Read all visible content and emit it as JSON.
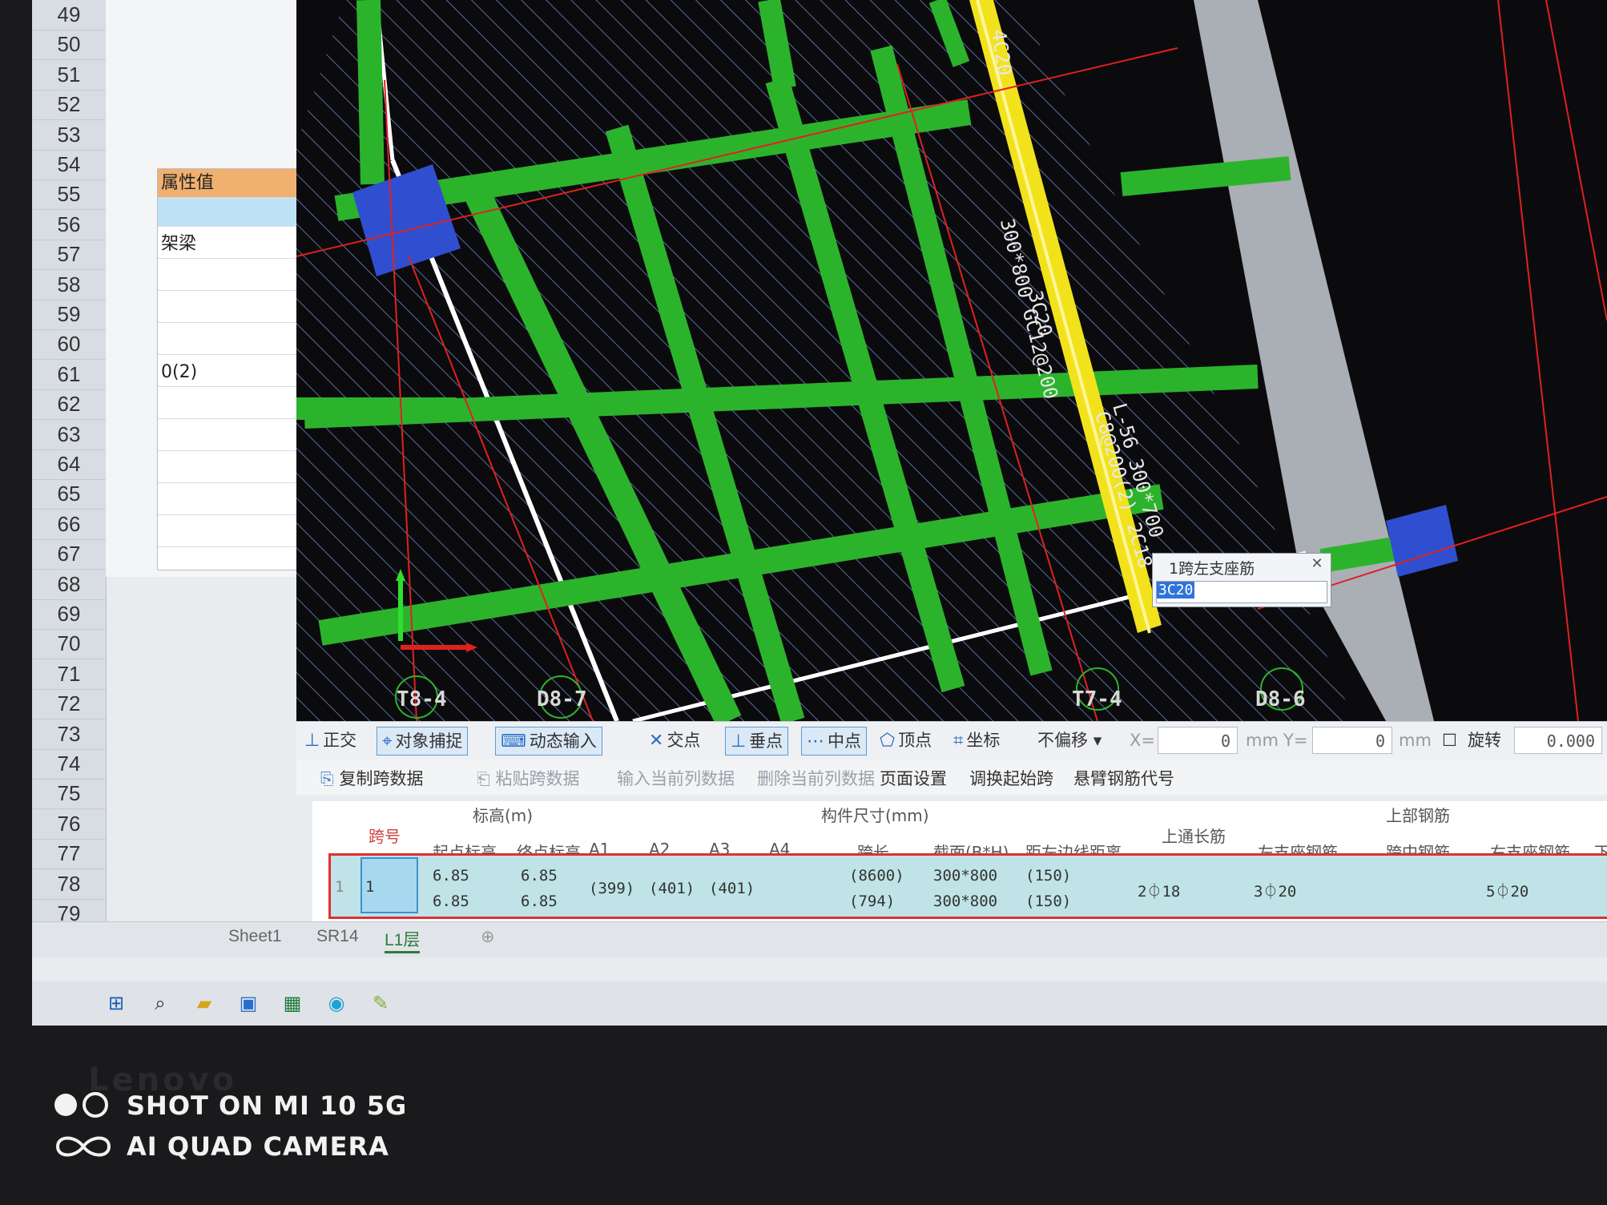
{
  "row_numbers": [
    "49",
    "50",
    "51",
    "52",
    "53",
    "54",
    "55",
    "56",
    "57",
    "58",
    "59",
    "60",
    "61",
    "62",
    "63",
    "64",
    "65",
    "66",
    "67",
    "68",
    "69",
    "70",
    "71",
    "72",
    "73",
    "74",
    "75",
    "76",
    "77",
    "78",
    "79"
  ],
  "props": {
    "header": "属性值",
    "rows": [
      "",
      "架梁",
      "",
      "",
      "",
      "0(2)",
      "",
      "",
      "",
      "",
      ""
    ]
  },
  "cad": {
    "axis_labels": [
      "T8-4",
      "D8-7",
      "T7-4",
      "D8-6"
    ],
    "beam_text_1": "300*800 GC12@200",
    "beam_text_2": "3C20",
    "beam_text_3": "L-56 300*700",
    "beam_text_4": "C8@200(2) 2C18",
    "beam_text_top": "4C20",
    "popup_title": "1跨左支座筋",
    "popup_value": "3C20"
  },
  "snapbar": {
    "ortho": "正交",
    "snap": "对象捕捉",
    "dynamic": "动态输入",
    "intersection": "交点",
    "perpendicular": "垂点",
    "midpoint": "中点",
    "vertex": "顶点",
    "coordinate": "坐标",
    "offset_mode": "不偏移",
    "x_label": "X=",
    "x_value": "0",
    "y_label": "Y=",
    "y_value": "0",
    "unit": "mm",
    "rotate_label": "旋转",
    "rotate_value": "0.000"
  },
  "cmdbar": {
    "copy": "复制跨数据",
    "paste": "粘贴跨数据",
    "input_col": "输入当前列数据",
    "delete_col": "删除当前列数据",
    "page_setup": "页面设置",
    "swap_start": "调换起始跨",
    "cantilever": "悬臂钢筋代号"
  },
  "table": {
    "h_span": "跨号",
    "h_elev": "标高(m)",
    "h_elev_start": "起点标高",
    "h_elev_end": "终点标高",
    "h_size": "构件尺寸(mm)",
    "h_a1": "A1",
    "h_a2": "A2",
    "h_a3": "A3",
    "h_a4": "A4",
    "h_span_len": "跨长",
    "h_section": "截面(B*H)",
    "h_edge_dist": "距左边线距离",
    "h_top_through": "上通长筋",
    "h_top_rebar": "上部钢筋",
    "h_left_support": "左支座钢筋",
    "h_mid_span": "跨中钢筋",
    "h_right_support": "右支座钢筋",
    "h_next": "下",
    "row": {
      "index": "1",
      "span": "1",
      "elev_start_1": "6.85",
      "elev_start_2": "6.85",
      "elev_end_1": "6.85",
      "elev_end_2": "6.85",
      "a1": "(399)",
      "a2": "(401)",
      "a3": "(401)",
      "span_len_1": "(8600)",
      "span_len_2": "(794)",
      "section_1": "300*800",
      "section_2": "300*800",
      "edge_1": "(150)",
      "edge_2": "(150)",
      "top_through": "2⏀18",
      "left_support": "3⏀20",
      "right_support": "5⏀20"
    }
  },
  "sheets": [
    "Sheet1",
    "SR14",
    "L1层"
  ],
  "watermark": {
    "line1": "SHOT ON MI 10 5G",
    "line2": "AI QUAD CAMERA"
  },
  "bezel_logo": "Lenovo"
}
